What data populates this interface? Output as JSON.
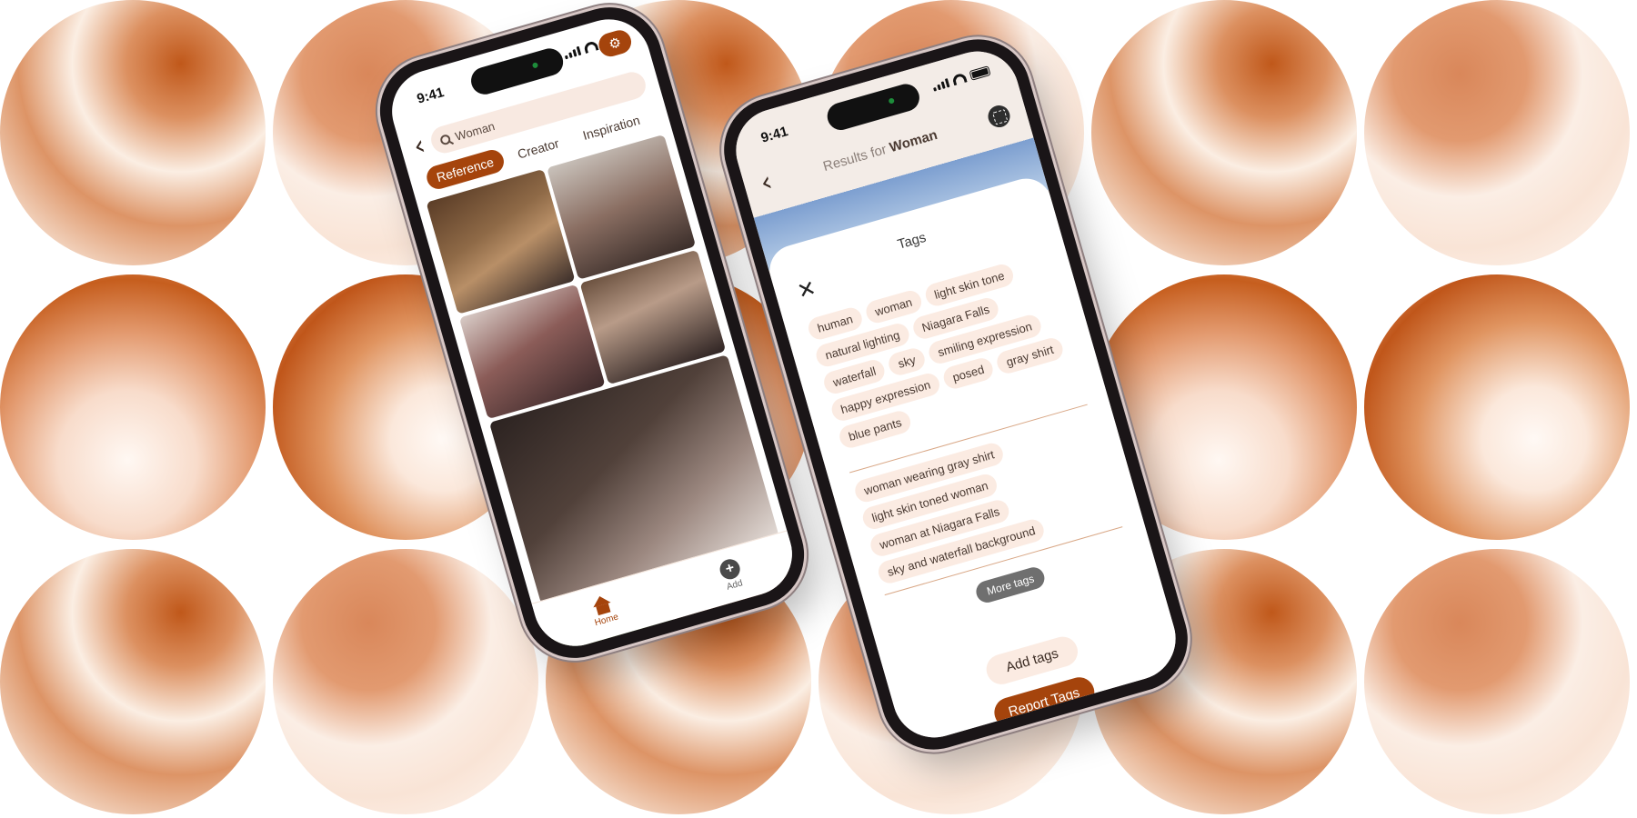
{
  "phone_left": {
    "status_time": "9:41",
    "search_value": "Woman",
    "tabs": [
      {
        "label": "Reference",
        "active": true
      },
      {
        "label": "Creator",
        "active": false
      },
      {
        "label": "Inspiration",
        "active": false
      }
    ],
    "nav": {
      "home": "Home",
      "add": "Add"
    }
  },
  "phone_right": {
    "status_time": "9:41",
    "results_prefix": "Results for",
    "results_query": "Woman",
    "sheet_title": "Tags",
    "tags": [
      "human",
      "woman",
      "light skin tone",
      "natural lighting",
      "Niagara Falls",
      "waterfall",
      "sky",
      "smiling expression",
      "happy expression",
      "posed",
      "gray shirt",
      "blue pants"
    ],
    "tag_phrases": [
      "woman wearing gray shirt",
      "light skin toned woman",
      "woman at Niagara Falls",
      "sky and waterfall background"
    ],
    "more_tags_label": "More tags",
    "add_tags_label": "Add tags",
    "report_tags_label": "Report Tags"
  },
  "colors": {
    "accent": "#a5440c",
    "chip_bg": "#fbebe2"
  }
}
